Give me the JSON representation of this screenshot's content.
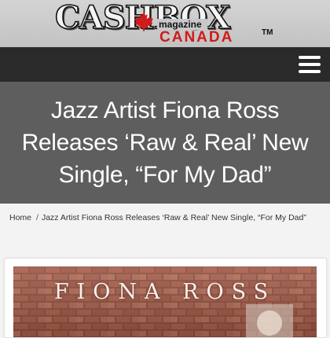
{
  "header": {
    "logo_word": "CASHBOX",
    "logo_magazine": "magazine",
    "logo_country": "CANADA",
    "logo_tm": "TM",
    "colors": {
      "brand_red": "#d11a1a",
      "header_bg": "#c8c8c8"
    }
  },
  "nav": {
    "menu_icon": "hamburger-menu-icon",
    "bar_color": "#2a2a2a"
  },
  "article": {
    "title": "Jazz Artist Fiona Ross Releases ‘Raw & Real’ New Single, “For My Dad”",
    "cover_text": "FIONA ROSS"
  },
  "breadcrumb": {
    "home": "Home",
    "separator": "/",
    "current": "Jazz Artist Fiona Ross Releases ‘Raw & Real’ New Single, “For My Dad”"
  },
  "colors": {
    "title_band": "#5e5e5e",
    "page_bg": "#f3f3f3"
  }
}
